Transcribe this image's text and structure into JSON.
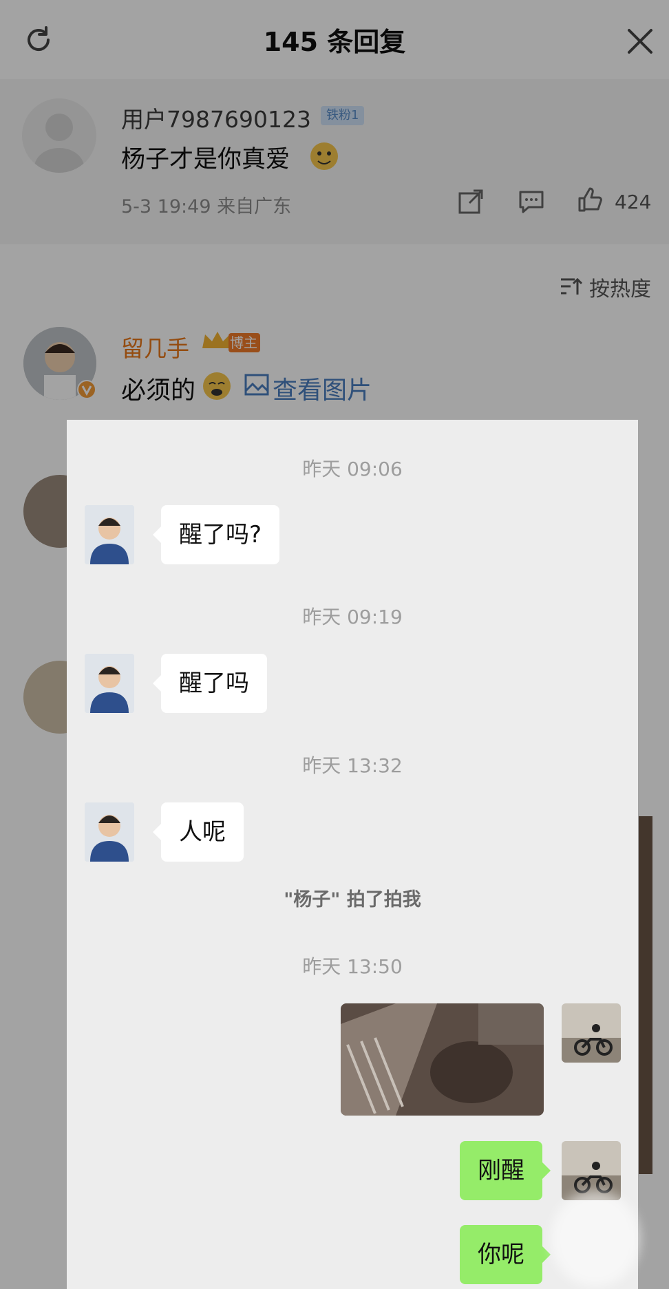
{
  "header": {
    "title": "145 条回复"
  },
  "top_comment": {
    "username": "用户7987690123",
    "badge": "铁粉1",
    "text": "杨子才是你真爱",
    "meta": "5-3 19:49  来自广东",
    "likes": "424"
  },
  "sort": {
    "label": "按热度"
  },
  "reply1": {
    "username": "留几手",
    "badge": "博主",
    "text": "必须的",
    "view_image": "查看图片"
  },
  "chat": {
    "messages": [
      {
        "time": "昨天 09:06",
        "text": "醒了吗?"
      },
      {
        "time": "昨天 09:19",
        "text": "醒了吗"
      },
      {
        "time": "昨天 13:32",
        "text": "人呢"
      }
    ],
    "system": "\"杨子\" 拍了拍我",
    "time4": "昨天 13:50",
    "my_messages": [
      "刚醒",
      "你呢"
    ]
  },
  "colors": {
    "accent_green": "#95ec69",
    "link_blue": "#4a7dbf",
    "vip_orange": "#e8781a"
  }
}
